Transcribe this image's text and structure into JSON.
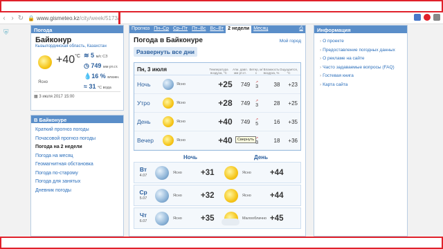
{
  "browser": {
    "url_domain": "www.gismeteo.kz",
    "url_path": "/city/week/5173/"
  },
  "left_panel": {
    "header": "Погода",
    "city": "Байконур",
    "region": "Кызылординская область, Казахстан",
    "temp": "+40",
    "temp_unit": "°C",
    "condition": "Ясно",
    "wind": "5",
    "wind_unit": "м/с СЗ",
    "pressure": "749",
    "pressure_unit": "мм рт.ст.",
    "humidity": "16 %",
    "humidity_unit": "влажн.",
    "water": "31",
    "water_unit": "°C вода",
    "date": "3 июля 2017 15:00"
  },
  "city_menu": {
    "header": "В Байконуре",
    "items": [
      {
        "label": "Краткий прогноз погоды",
        "active": false
      },
      {
        "label": "Почасовой прогноз погоды",
        "active": false
      },
      {
        "label": "Погода на 2 недели",
        "active": true
      },
      {
        "label": "Погода на месяц",
        "active": false
      },
      {
        "label": "Геомагнитная обстановка",
        "active": false
      },
      {
        "label": "Погода по-старому",
        "active": false
      },
      {
        "label": "Погода для занятых",
        "active": false
      },
      {
        "label": "Дневник погоды",
        "active": false
      }
    ]
  },
  "tabs": [
    "Прогноз",
    "Пн–Ср",
    "Ср–Пт",
    "Пт–Вс",
    "Вс–Вт",
    "2 недели",
    "Месяц"
  ],
  "main": {
    "title": "Погода в Байконуре",
    "other_city": "Мой город",
    "expand_all": "Развернуть все дни",
    "day_title": "Пн, 3 июля",
    "columns": [
      "Температура воздуха, °C",
      "Атм. давл. мм рт.ст.",
      "Ветер, м/с",
      "Влажность воздуха, %",
      "Ощущается, °C"
    ],
    "rows": [
      {
        "tod": "Ночь",
        "cond": "Ясно",
        "temp": "+25",
        "pressure": "749",
        "wind": "3",
        "hum": "38",
        "feel": "+23",
        "icon": "night"
      },
      {
        "tod": "Утро",
        "cond": "Ясно",
        "temp": "+28",
        "pressure": "749",
        "wind": "3",
        "hum": "28",
        "feel": "+25",
        "icon": "sun"
      },
      {
        "tod": "День",
        "cond": "Ясно",
        "temp": "+40",
        "pressure": "749",
        "wind": "5",
        "hum": "16",
        "feel": "+35",
        "icon": "sun"
      },
      {
        "tod": "Вечер",
        "cond": "Ясно",
        "temp": "+40",
        "pressure": "749",
        "wind": "3",
        "hum": "18",
        "feel": "+36",
        "icon": "sun"
      }
    ],
    "tooltip": "Свернуть",
    "night_label": "Ночь",
    "day_label": "День",
    "forecast": [
      {
        "day": "Вт",
        "date": "4.07",
        "ncond": "Ясно",
        "ntemp": "+31",
        "dcond": "Ясно",
        "dtemp": "+44"
      },
      {
        "day": "Ср",
        "date": "5.07",
        "ncond": "Ясно",
        "ntemp": "+32",
        "dcond": "Ясно",
        "dtemp": "+44"
      },
      {
        "day": "Чт",
        "date": "6.07",
        "ncond": "Ясно",
        "ntemp": "+35",
        "dcond": "Малооблачно",
        "dtemp": "+45"
      }
    ]
  },
  "info": {
    "header": "Информация",
    "items": [
      "О проекте",
      "Предоставление погодных данных",
      "О рекламе на сайте",
      "Часто задаваемые вопросы (FAQ)",
      "Гостевая книга",
      "Карта сайта"
    ]
  }
}
